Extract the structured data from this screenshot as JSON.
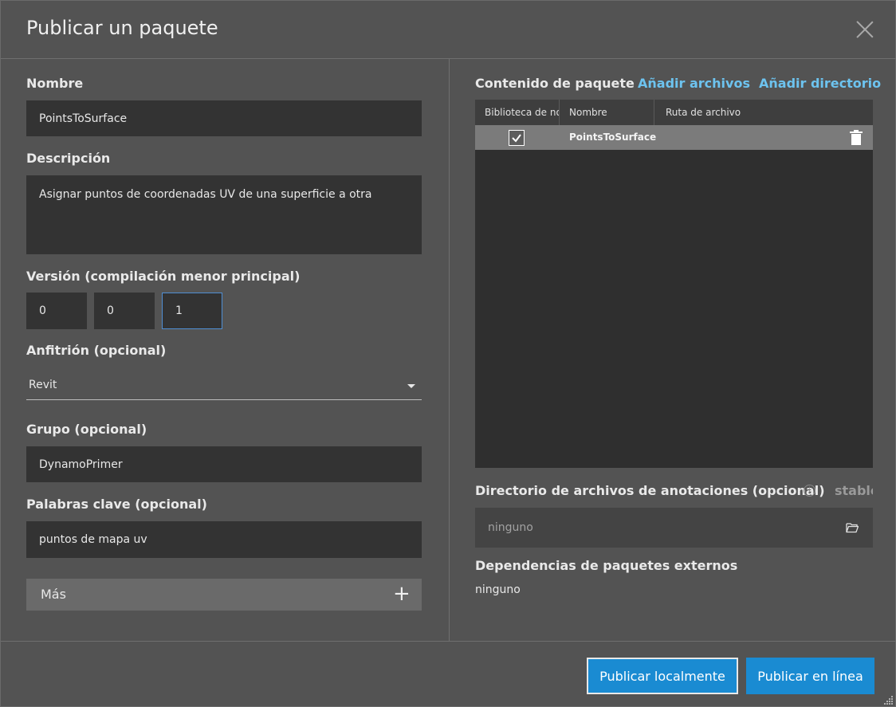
{
  "dialog": {
    "title": "Publicar un paquete"
  },
  "left": {
    "name_label": "Nombre",
    "name_value": "PointsToSurface",
    "description_label": "Descripción",
    "description_value": "Asignar puntos de coordenadas UV de una superficie a otra",
    "version_label": "Versión (compilación menor principal)",
    "version_major": "0",
    "version_minor": "0",
    "version_build": "1",
    "host_label": "Anfitrión (opcional)",
    "host_value": "Revit",
    "group_label": "Grupo (opcional)",
    "group_value": "DynamoPrimer",
    "keywords_label": "Palabras clave (opcional)",
    "keywords_value": "puntos de mapa uv",
    "more_label": "Más",
    "more_icon": "+"
  },
  "right": {
    "contents_label": "Contenido de paquete",
    "add_files": "Añadir archivos",
    "add_directory": "Añadir directorio",
    "table": {
      "headers": [
        "Biblioteca de no",
        "Nombre",
        "Ruta de archivo"
      ],
      "rows": [
        {
          "checked": true,
          "name": "PointsToSurface",
          "path": ""
        }
      ]
    },
    "notes_label": "Directorio de archivos de anotaciones (opcional)",
    "notes_suffix": "stable",
    "notes_value": "ninguno",
    "deps_label": "Dependencias de paquetes externos",
    "deps_value": "ninguno"
  },
  "footer": {
    "publish_local": "Publicar localmente",
    "publish_online": "Publicar en línea"
  },
  "colors": {
    "accent": "#1a8bd2",
    "link": "#6dc3ef",
    "panel": "#535353",
    "field": "#333333"
  }
}
